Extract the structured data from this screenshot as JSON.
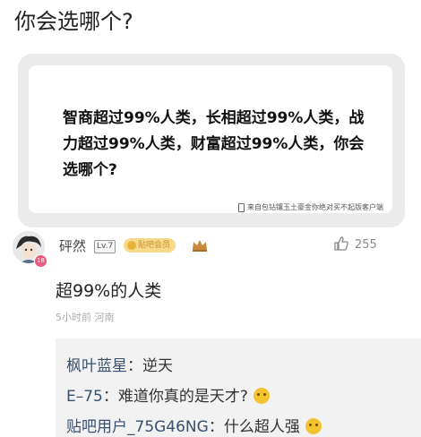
{
  "post": {
    "question": "你会选哪个?"
  },
  "card": {
    "text": "智商超过99%人类，长相超过99%人类，战力超过99%人类，财富超过99%人类，你会选哪个?",
    "footer": "来自包钻镶玉土豪金你绝对买不起版客户端"
  },
  "comment": {
    "username": "砰然",
    "level": "Lv.7",
    "badge": "贴吧会员",
    "badge_number": "18",
    "likes": "255",
    "text": "超99%的人类",
    "meta": "5小时前 河南"
  },
  "replies": [
    {
      "name": "枫叶蓝星",
      "sep": "：",
      "body": "逆天",
      "emoji": ""
    },
    {
      "name": "E–75",
      "sep": "：",
      "body": "难道你真的是天才?",
      "emoji": "cry-laugh-emoji"
    },
    {
      "name": "贴吧用户_75G46NG",
      "sep": "：",
      "body": "什么超人强",
      "emoji": "cry-laugh-emoji"
    }
  ],
  "colors": {
    "reply_name": "#3b4f6e",
    "card_frame": "#ebebeb",
    "reply_bg": "#f2f2f2",
    "badge_gold": "#f6d98a"
  }
}
